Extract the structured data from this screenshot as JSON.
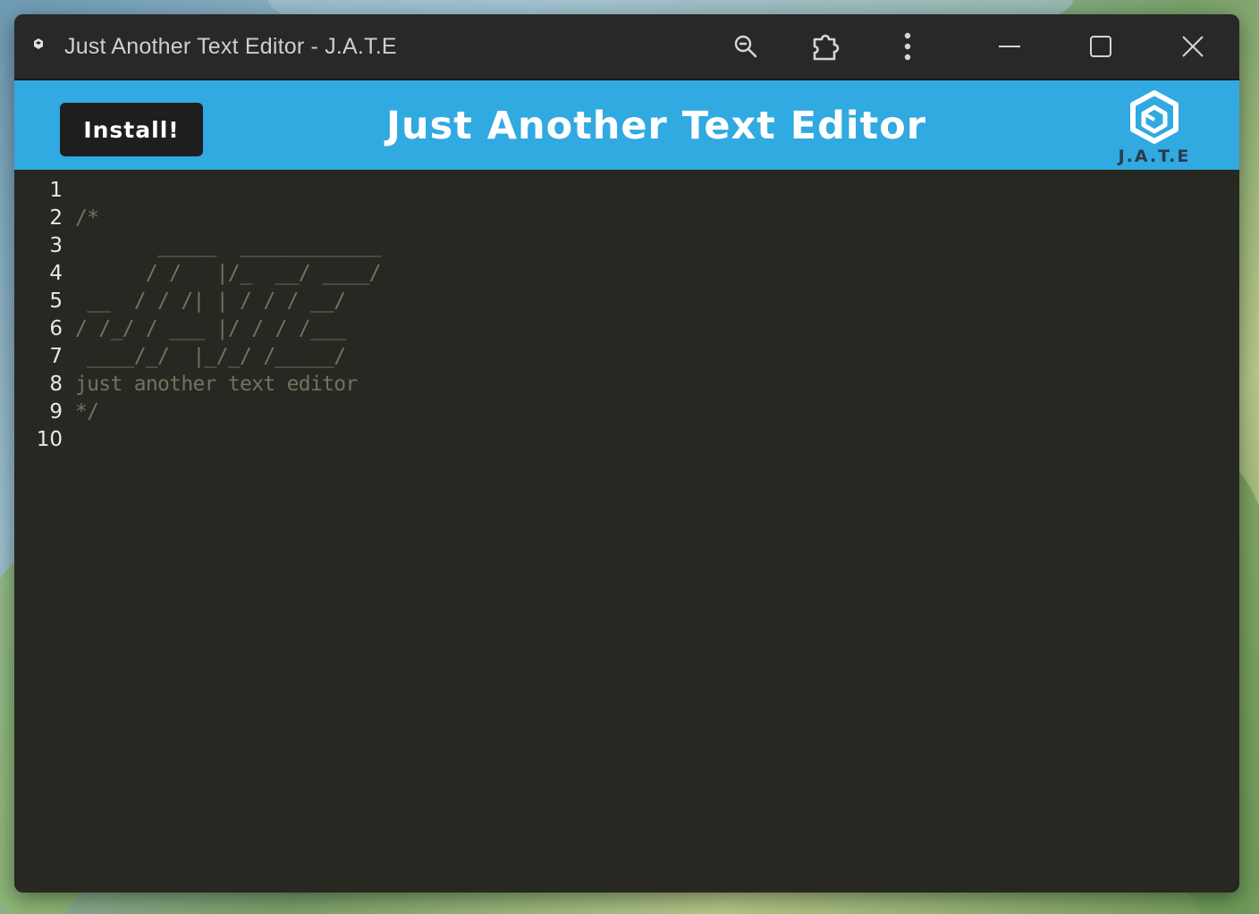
{
  "window": {
    "title": "Just Another Text Editor - J.A.T.E"
  },
  "titlebar": {
    "icons": [
      "zoom-out-icon",
      "extension-icon",
      "more-options-icon",
      "minimize-icon",
      "maximize-icon",
      "close-icon"
    ]
  },
  "header": {
    "install_label": "Install!",
    "heading": "Just Another Text Editor",
    "logo_text": "J.A.T.E",
    "background_color": "#31a9e1",
    "install_bg_color": "#1e1e1e"
  },
  "editor": {
    "background_color": "#272822",
    "comment_color": "#75715e",
    "lines": [
      {
        "num": "1",
        "text": ""
      },
      {
        "num": "2",
        "text": "/*"
      },
      {
        "num": "3",
        "text": "       _____  ____________"
      },
      {
        "num": "4",
        "text": "      / /   |/_  __/ ____/"
      },
      {
        "num": "5",
        "text": " __  / / /| | / / / __/"
      },
      {
        "num": "6",
        "text": "/ /_/ / ___ |/ / / /___"
      },
      {
        "num": "7",
        "text": " ____/_/  |_/_/ /_____/"
      },
      {
        "num": "8",
        "text": "just another text editor"
      },
      {
        "num": "9",
        "text": "*/"
      },
      {
        "num": "10",
        "text": ""
      }
    ]
  }
}
